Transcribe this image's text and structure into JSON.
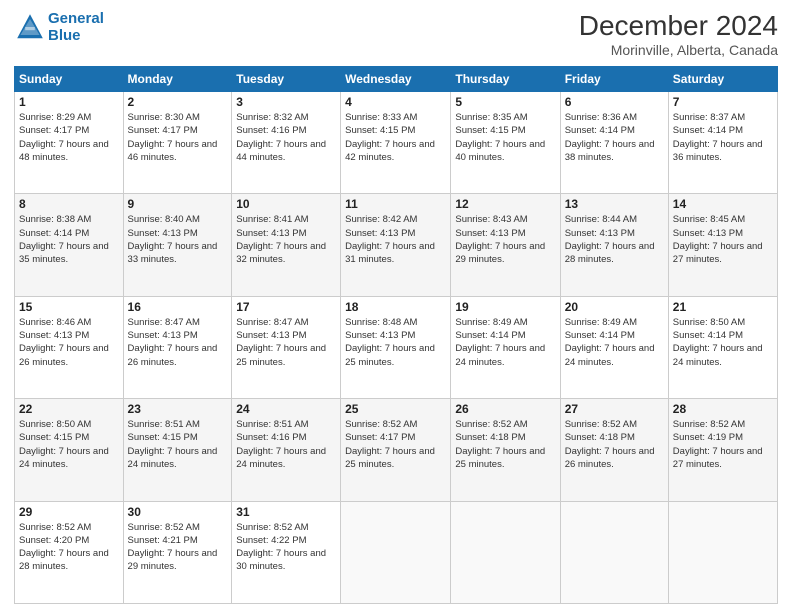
{
  "header": {
    "logo_line1": "General",
    "logo_line2": "Blue",
    "title": "December 2024",
    "subtitle": "Morinville, Alberta, Canada"
  },
  "days_of_week": [
    "Sunday",
    "Monday",
    "Tuesday",
    "Wednesday",
    "Thursday",
    "Friday",
    "Saturday"
  ],
  "weeks": [
    [
      {
        "day": "1",
        "sunrise": "Sunrise: 8:29 AM",
        "sunset": "Sunset: 4:17 PM",
        "daylight": "Daylight: 7 hours and 48 minutes."
      },
      {
        "day": "2",
        "sunrise": "Sunrise: 8:30 AM",
        "sunset": "Sunset: 4:17 PM",
        "daylight": "Daylight: 7 hours and 46 minutes."
      },
      {
        "day": "3",
        "sunrise": "Sunrise: 8:32 AM",
        "sunset": "Sunset: 4:16 PM",
        "daylight": "Daylight: 7 hours and 44 minutes."
      },
      {
        "day": "4",
        "sunrise": "Sunrise: 8:33 AM",
        "sunset": "Sunset: 4:15 PM",
        "daylight": "Daylight: 7 hours and 42 minutes."
      },
      {
        "day": "5",
        "sunrise": "Sunrise: 8:35 AM",
        "sunset": "Sunset: 4:15 PM",
        "daylight": "Daylight: 7 hours and 40 minutes."
      },
      {
        "day": "6",
        "sunrise": "Sunrise: 8:36 AM",
        "sunset": "Sunset: 4:14 PM",
        "daylight": "Daylight: 7 hours and 38 minutes."
      },
      {
        "day": "7",
        "sunrise": "Sunrise: 8:37 AM",
        "sunset": "Sunset: 4:14 PM",
        "daylight": "Daylight: 7 hours and 36 minutes."
      }
    ],
    [
      {
        "day": "8",
        "sunrise": "Sunrise: 8:38 AM",
        "sunset": "Sunset: 4:14 PM",
        "daylight": "Daylight: 7 hours and 35 minutes."
      },
      {
        "day": "9",
        "sunrise": "Sunrise: 8:40 AM",
        "sunset": "Sunset: 4:13 PM",
        "daylight": "Daylight: 7 hours and 33 minutes."
      },
      {
        "day": "10",
        "sunrise": "Sunrise: 8:41 AM",
        "sunset": "Sunset: 4:13 PM",
        "daylight": "Daylight: 7 hours and 32 minutes."
      },
      {
        "day": "11",
        "sunrise": "Sunrise: 8:42 AM",
        "sunset": "Sunset: 4:13 PM",
        "daylight": "Daylight: 7 hours and 31 minutes."
      },
      {
        "day": "12",
        "sunrise": "Sunrise: 8:43 AM",
        "sunset": "Sunset: 4:13 PM",
        "daylight": "Daylight: 7 hours and 29 minutes."
      },
      {
        "day": "13",
        "sunrise": "Sunrise: 8:44 AM",
        "sunset": "Sunset: 4:13 PM",
        "daylight": "Daylight: 7 hours and 28 minutes."
      },
      {
        "day": "14",
        "sunrise": "Sunrise: 8:45 AM",
        "sunset": "Sunset: 4:13 PM",
        "daylight": "Daylight: 7 hours and 27 minutes."
      }
    ],
    [
      {
        "day": "15",
        "sunrise": "Sunrise: 8:46 AM",
        "sunset": "Sunset: 4:13 PM",
        "daylight": "Daylight: 7 hours and 26 minutes."
      },
      {
        "day": "16",
        "sunrise": "Sunrise: 8:47 AM",
        "sunset": "Sunset: 4:13 PM",
        "daylight": "Daylight: 7 hours and 26 minutes."
      },
      {
        "day": "17",
        "sunrise": "Sunrise: 8:47 AM",
        "sunset": "Sunset: 4:13 PM",
        "daylight": "Daylight: 7 hours and 25 minutes."
      },
      {
        "day": "18",
        "sunrise": "Sunrise: 8:48 AM",
        "sunset": "Sunset: 4:13 PM",
        "daylight": "Daylight: 7 hours and 25 minutes."
      },
      {
        "day": "19",
        "sunrise": "Sunrise: 8:49 AM",
        "sunset": "Sunset: 4:14 PM",
        "daylight": "Daylight: 7 hours and 24 minutes."
      },
      {
        "day": "20",
        "sunrise": "Sunrise: 8:49 AM",
        "sunset": "Sunset: 4:14 PM",
        "daylight": "Daylight: 7 hours and 24 minutes."
      },
      {
        "day": "21",
        "sunrise": "Sunrise: 8:50 AM",
        "sunset": "Sunset: 4:14 PM",
        "daylight": "Daylight: 7 hours and 24 minutes."
      }
    ],
    [
      {
        "day": "22",
        "sunrise": "Sunrise: 8:50 AM",
        "sunset": "Sunset: 4:15 PM",
        "daylight": "Daylight: 7 hours and 24 minutes."
      },
      {
        "day": "23",
        "sunrise": "Sunrise: 8:51 AM",
        "sunset": "Sunset: 4:15 PM",
        "daylight": "Daylight: 7 hours and 24 minutes."
      },
      {
        "day": "24",
        "sunrise": "Sunrise: 8:51 AM",
        "sunset": "Sunset: 4:16 PM",
        "daylight": "Daylight: 7 hours and 24 minutes."
      },
      {
        "day": "25",
        "sunrise": "Sunrise: 8:52 AM",
        "sunset": "Sunset: 4:17 PM",
        "daylight": "Daylight: 7 hours and 25 minutes."
      },
      {
        "day": "26",
        "sunrise": "Sunrise: 8:52 AM",
        "sunset": "Sunset: 4:18 PM",
        "daylight": "Daylight: 7 hours and 25 minutes."
      },
      {
        "day": "27",
        "sunrise": "Sunrise: 8:52 AM",
        "sunset": "Sunset: 4:18 PM",
        "daylight": "Daylight: 7 hours and 26 minutes."
      },
      {
        "day": "28",
        "sunrise": "Sunrise: 8:52 AM",
        "sunset": "Sunset: 4:19 PM",
        "daylight": "Daylight: 7 hours and 27 minutes."
      }
    ],
    [
      {
        "day": "29",
        "sunrise": "Sunrise: 8:52 AM",
        "sunset": "Sunset: 4:20 PM",
        "daylight": "Daylight: 7 hours and 28 minutes."
      },
      {
        "day": "30",
        "sunrise": "Sunrise: 8:52 AM",
        "sunset": "Sunset: 4:21 PM",
        "daylight": "Daylight: 7 hours and 29 minutes."
      },
      {
        "day": "31",
        "sunrise": "Sunrise: 8:52 AM",
        "sunset": "Sunset: 4:22 PM",
        "daylight": "Daylight: 7 hours and 30 minutes."
      },
      null,
      null,
      null,
      null
    ]
  ]
}
